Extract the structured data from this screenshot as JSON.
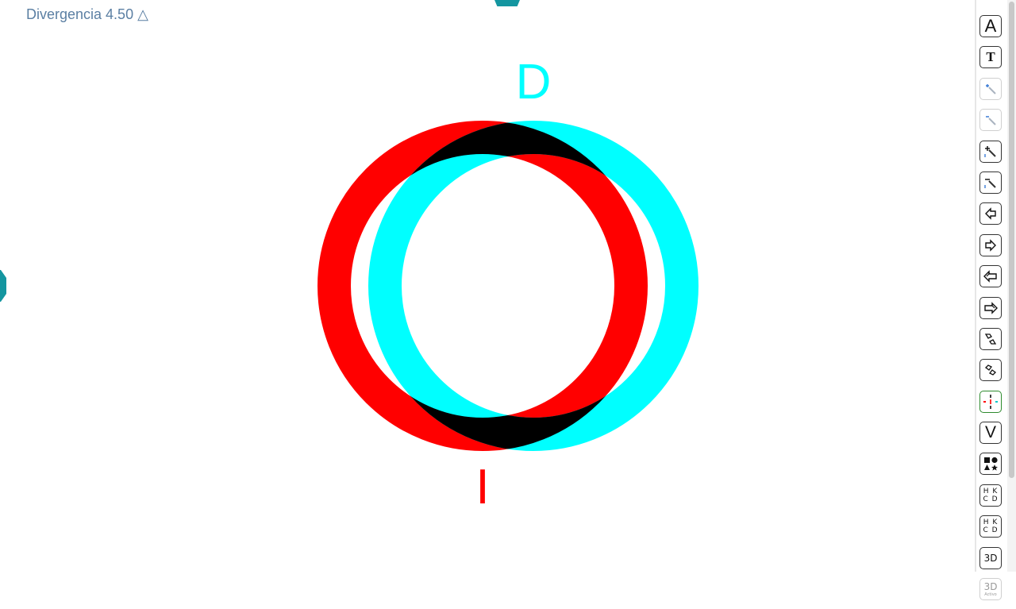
{
  "divergence": {
    "label": "Divergencia 4.50",
    "symbol": "△"
  },
  "stereo": {
    "top_letter": "D",
    "bottom_letter": "I",
    "colors": {
      "left_ring": "#ff0000",
      "right_ring": "#00ffff",
      "overlap": "#000000"
    }
  },
  "toolbar": {
    "font_size_label": "A",
    "text_label": "T",
    "letters_chart_a": "H K\nC D",
    "letters_chart_b": "H K\nC D",
    "three_d_label": "3D",
    "three_d_active_label": "3D",
    "three_d_active_caption": "Activo",
    "vertical_label": "V",
    "tools": [
      {
        "name": "font-size-tool",
        "icon": "letter-a-icon"
      },
      {
        "name": "text-tool",
        "icon": "letter-t-icon"
      },
      {
        "name": "zoom-in-tool",
        "icon": "zoom-in-icon"
      },
      {
        "name": "zoom-out-tool",
        "icon": "zoom-out-icon"
      },
      {
        "name": "zoom-in-fine-tool",
        "icon": "zoom-in-plus-icon"
      },
      {
        "name": "zoom-out-fine-tool",
        "icon": "zoom-out-minus-icon"
      },
      {
        "name": "move-left-tool",
        "icon": "arrow-left-icon"
      },
      {
        "name": "move-right-tool",
        "icon": "arrow-right-icon"
      },
      {
        "name": "move-left-double-tool",
        "icon": "double-arrow-left-icon"
      },
      {
        "name": "move-right-double-tool",
        "icon": "double-arrow-right-icon"
      },
      {
        "name": "diagonal-down-tool",
        "icon": "diagonal-arrows-down-icon"
      },
      {
        "name": "diagonal-up-tool",
        "icon": "diagonal-arrows-up-icon"
      },
      {
        "name": "cross-target-tool",
        "icon": "cross-target-icon"
      },
      {
        "name": "vertical-tool",
        "icon": "letter-v-icon"
      },
      {
        "name": "shapes-tool",
        "icon": "shapes-icon"
      },
      {
        "name": "letters-chart-tool",
        "icon": "letters-chart-icon"
      },
      {
        "name": "letters-chart-alt-tool",
        "icon": "letters-chart-alt-icon"
      },
      {
        "name": "three-d-tool",
        "icon": "three-d-icon"
      },
      {
        "name": "three-d-active-tool",
        "icon": "three-d-active-icon"
      }
    ]
  }
}
